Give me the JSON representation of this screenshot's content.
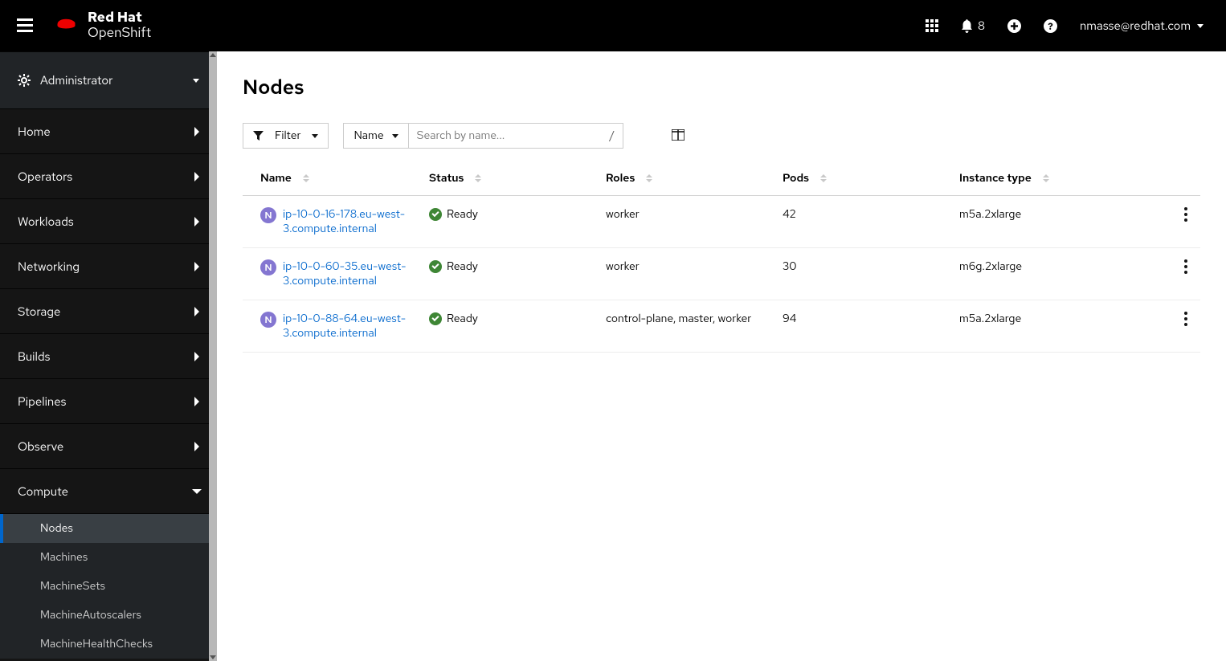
{
  "brand": {
    "line1": "Red Hat",
    "line2": "OpenShift"
  },
  "masthead": {
    "notification_count": "8",
    "user": "nmasse@redhat.com"
  },
  "sidebar": {
    "perspective": "Administrator",
    "items": [
      {
        "label": "Home",
        "expanded": false
      },
      {
        "label": "Operators",
        "expanded": false
      },
      {
        "label": "Workloads",
        "expanded": false
      },
      {
        "label": "Networking",
        "expanded": false
      },
      {
        "label": "Storage",
        "expanded": false
      },
      {
        "label": "Builds",
        "expanded": false
      },
      {
        "label": "Pipelines",
        "expanded": false
      },
      {
        "label": "Observe",
        "expanded": false
      },
      {
        "label": "Compute",
        "expanded": true
      }
    ],
    "compute_sub": [
      {
        "label": "Nodes",
        "active": true
      },
      {
        "label": "Machines",
        "active": false
      },
      {
        "label": "MachineSets",
        "active": false
      },
      {
        "label": "MachineAutoscalers",
        "active": false
      },
      {
        "label": "MachineHealthChecks",
        "active": false
      }
    ]
  },
  "page": {
    "title": "Nodes",
    "filter_label": "Filter",
    "name_select": "Name",
    "search_placeholder": "Search by name...",
    "search_suffix": "/"
  },
  "table": {
    "columns": [
      "Name",
      "Status",
      "Roles",
      "Pods",
      "Instance type"
    ],
    "rows": [
      {
        "badge": "N",
        "name": "ip-10-0-16-178.eu-west-3.compute.internal",
        "status": "Ready",
        "roles": "worker",
        "pods": "42",
        "instance": "m5a.2xlarge"
      },
      {
        "badge": "N",
        "name": "ip-10-0-60-35.eu-west-3.compute.internal",
        "status": "Ready",
        "roles": "worker",
        "pods": "30",
        "instance": "m6g.2xlarge"
      },
      {
        "badge": "N",
        "name": "ip-10-0-88-64.eu-west-3.compute.internal",
        "status": "Ready",
        "roles": "control-plane, master, worker",
        "pods": "94",
        "instance": "m5a.2xlarge"
      }
    ]
  }
}
